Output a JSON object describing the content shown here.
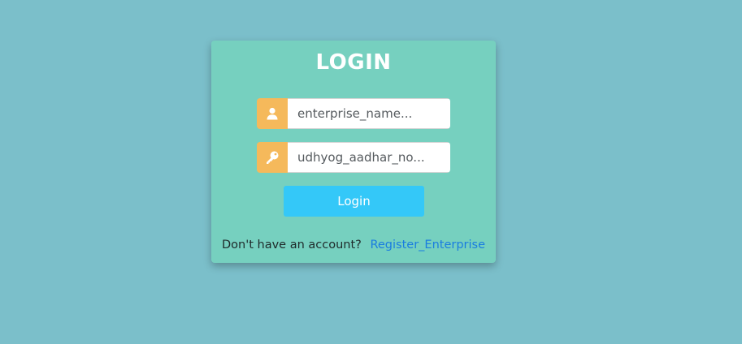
{
  "page": {
    "background_color": "#7bbfca"
  },
  "login_card": {
    "title": "LOGIN",
    "background_color": "#76d0bf",
    "username_field": {
      "placeholder": "enterprise_name...",
      "value": "",
      "icon": "user-icon",
      "icon_bg_color": "#f5b95b"
    },
    "password_field": {
      "placeholder": "udhyog_aadhar_no...",
      "value": "",
      "icon": "key-icon",
      "icon_bg_color": "#f5b95b"
    },
    "login_button": {
      "label": "Login",
      "color": "#34c8f8"
    },
    "footer": {
      "prompt_text": "Don't have an account?",
      "register_link_text": "Register_Enterprise",
      "link_color": "#1a7de0"
    }
  }
}
